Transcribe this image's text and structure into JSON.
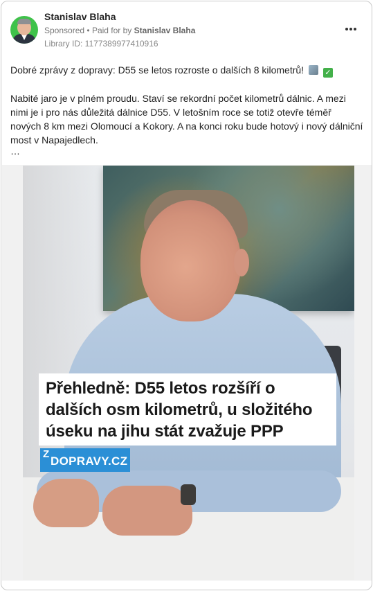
{
  "post": {
    "author_name": "Stanislav Blaha",
    "sponsored_label": "Sponsored",
    "separator": "•",
    "paid_for_prefix": "Paid for by",
    "paid_for_name": "Stanislav Blaha",
    "library_id": "Library ID: 1177389977410916",
    "more_menu_icon": "more-horizontal-icon",
    "headline": "Dobré zprávy z dopravy: D55 se letos rozroste o dalších 8 kilometrů!",
    "headline_emojis": [
      "motorway-icon",
      "check-mark-button-icon"
    ],
    "body": "Nabité jaro je v plném proudu. Staví se rekordní počet kilometrů dálnic. A mezi nimi je i pro nás důležitá dálnice D55. V letošním roce se totiž otevře téměř nových 8 km mezi Olomoucí a Kokory. A na konci roku bude hotový i nový dálniční most v Napajedlech.",
    "truncation": "…"
  },
  "media": {
    "caption": "Přehledně: D55 letos rozšíří o dalších osm kilometrů, u složitého úseku na jihu stát zvažuje PPP",
    "logo_z": "Z",
    "logo_text": "DOPRAVY.CZ",
    "logo_color": "#2b8fd6"
  }
}
